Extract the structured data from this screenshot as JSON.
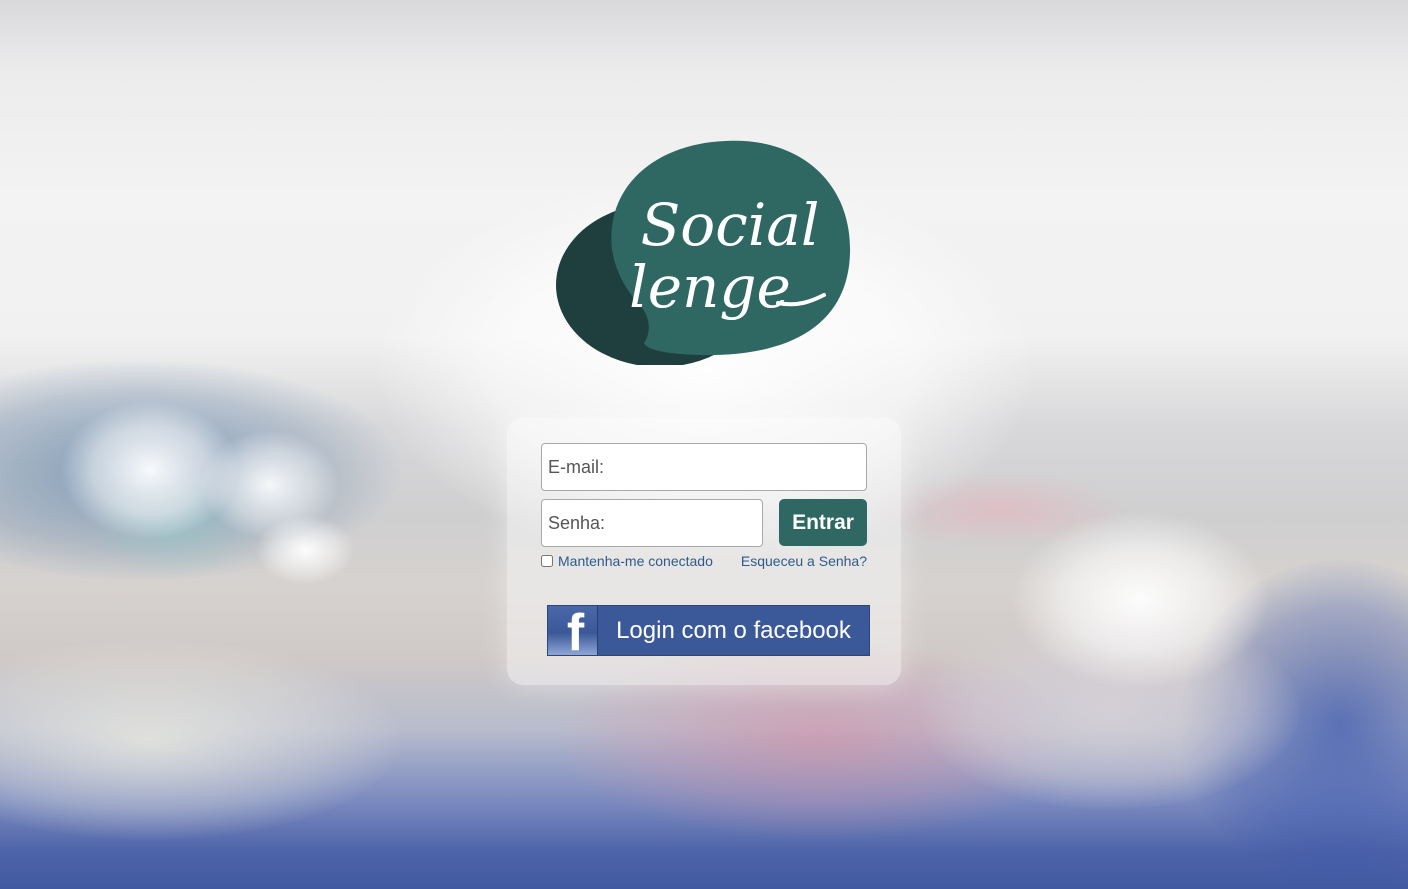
{
  "brand": {
    "logo_text_line1": "Social",
    "logo_text_line2": "lenge",
    "logo_color_main": "#2f6763",
    "logo_color_dark": "#1f3f3e"
  },
  "login": {
    "email_placeholder": "E-mail:",
    "password_placeholder": "Senha:",
    "submit_label": "Entrar",
    "remember_label": "Mantenha-me conectado",
    "remember_checked": false,
    "forgot_label": "Esqueceu a Senha?"
  },
  "facebook": {
    "icon": "facebook-f-icon",
    "icon_glyph": "f",
    "label": "Login com o facebook",
    "color": "#3b5998"
  },
  "colors": {
    "accent": "#2f6763",
    "link": "#2e5b8a"
  }
}
